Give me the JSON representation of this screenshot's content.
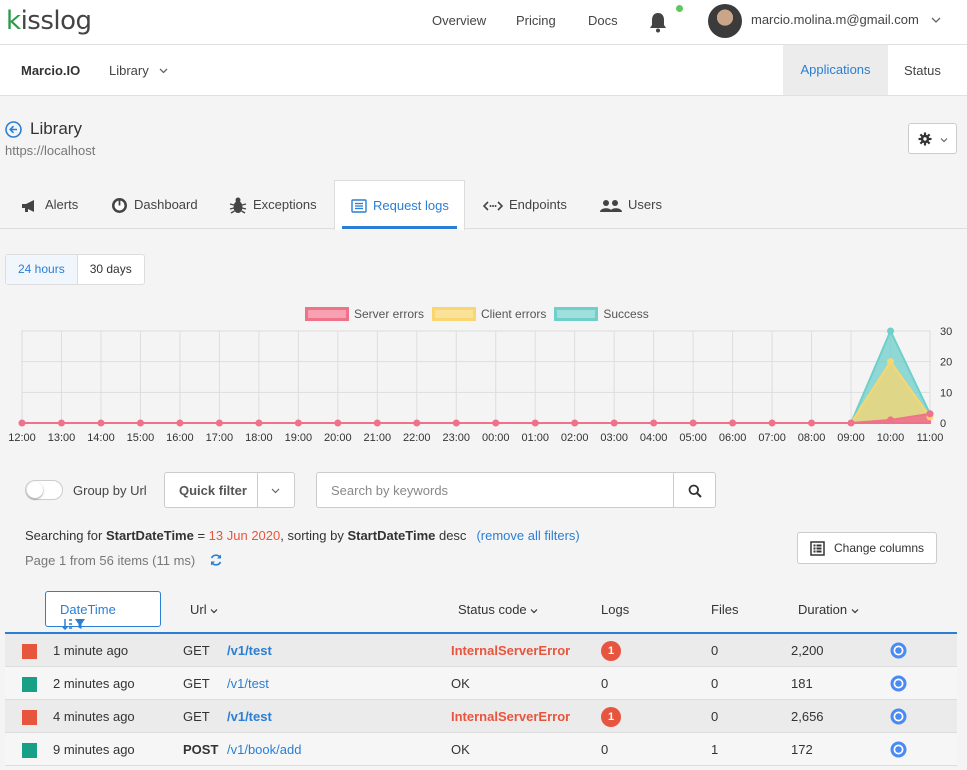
{
  "brand": {
    "logo_k": "k",
    "logo_rest": "isslog"
  },
  "topnav": {
    "links": [
      "Overview",
      "Pricing",
      "Docs"
    ],
    "user_email": "marcio.molina.m@gmail.com",
    "icons": [
      "bell-icon",
      "avatar",
      "chevron-down-icon"
    ]
  },
  "subnav": {
    "org": "Marcio.IO",
    "app": "Library",
    "applications_tab": "Applications",
    "status_link": "Status"
  },
  "header": {
    "title": "Library",
    "url": "https://localhost"
  },
  "tabs": [
    {
      "label": "Alerts",
      "icon": "megaphone-icon"
    },
    {
      "label": "Dashboard",
      "icon": "gauge-icon"
    },
    {
      "label": "Exceptions",
      "icon": "bug-icon"
    },
    {
      "label": "Request logs",
      "icon": "list-icon",
      "active": true
    },
    {
      "label": "Endpoints",
      "icon": "code-arrows-icon"
    },
    {
      "label": "Users",
      "icon": "users-icon"
    }
  ],
  "range": {
    "option1": "24 hours",
    "option2": "30 days",
    "selected": "24 hours"
  },
  "chart_data": {
    "type": "area",
    "x": [
      "12:00",
      "13:00",
      "14:00",
      "15:00",
      "16:00",
      "17:00",
      "18:00",
      "19:00",
      "20:00",
      "21:00",
      "22:00",
      "23:00",
      "00:00",
      "01:00",
      "02:00",
      "03:00",
      "04:00",
      "05:00",
      "06:00",
      "07:00",
      "08:00",
      "09:00",
      "10:00",
      "11:00"
    ],
    "series": [
      {
        "name": "Server errors",
        "color": "#f0718a",
        "values": [
          0,
          0,
          0,
          0,
          0,
          0,
          0,
          0,
          0,
          0,
          0,
          0,
          0,
          0,
          0,
          0,
          0,
          0,
          0,
          0,
          0,
          0,
          1,
          3
        ]
      },
      {
        "name": "Client errors",
        "color": "#f9d66e",
        "values": [
          0,
          0,
          0,
          0,
          0,
          0,
          0,
          0,
          0,
          0,
          0,
          0,
          0,
          0,
          0,
          0,
          0,
          0,
          0,
          0,
          0,
          0,
          20,
          2
        ]
      },
      {
        "name": "Success",
        "color": "#6ecfcb",
        "values": [
          0,
          0,
          0,
          0,
          0,
          0,
          0,
          0,
          0,
          0,
          0,
          0,
          0,
          0,
          0,
          0,
          0,
          0,
          0,
          0,
          0,
          0,
          30,
          3
        ]
      }
    ],
    "yticks": [
      "0",
      "10",
      "20",
      "30"
    ],
    "ylim": [
      0,
      30
    ],
    "grid": true,
    "legend": "top-center"
  },
  "filters": {
    "group_label": "Group by Url",
    "quick_filter": "Quick filter",
    "search_placeholder": "Search by keywords"
  },
  "info": {
    "prefix": "Searching for ",
    "field": "StartDateTime",
    "op": " = ",
    "date": "13 Jun 2020",
    "sorting": ", sorting by ",
    "sort_field": "StartDateTime",
    "sort_dir": " desc",
    "remove": "(remove all filters)",
    "page": "Page 1 from 56 items (11 ms)",
    "change_columns": "Change columns"
  },
  "table": {
    "headers": {
      "datetime": "DateTime",
      "url": "Url",
      "status": "Status code",
      "logs": "Logs",
      "files": "Files",
      "duration": "Duration"
    },
    "rows": [
      {
        "time": "1 minute ago",
        "method": "GET",
        "url": "/v1/test",
        "status": "InternalServerError",
        "logs": "1",
        "files": "0",
        "duration": "2,200",
        "kind": "error"
      },
      {
        "time": "2 minutes ago",
        "method": "GET",
        "url": "/v1/test",
        "status": "OK",
        "logs": "0",
        "files": "0",
        "duration": "181",
        "kind": "ok"
      },
      {
        "time": "4 minutes ago",
        "method": "GET",
        "url": "/v1/test",
        "status": "InternalServerError",
        "logs": "1",
        "files": "0",
        "duration": "2,656",
        "kind": "error"
      },
      {
        "time": "9 minutes ago",
        "method": "POST",
        "url": "/v1/book/add",
        "status": "OK",
        "logs": "0",
        "files": "1",
        "duration": "172",
        "kind": "ok"
      }
    ]
  },
  "colors": {
    "accent": "#2a7fd4",
    "error": "#e8553e",
    "ok": "#17a085"
  }
}
